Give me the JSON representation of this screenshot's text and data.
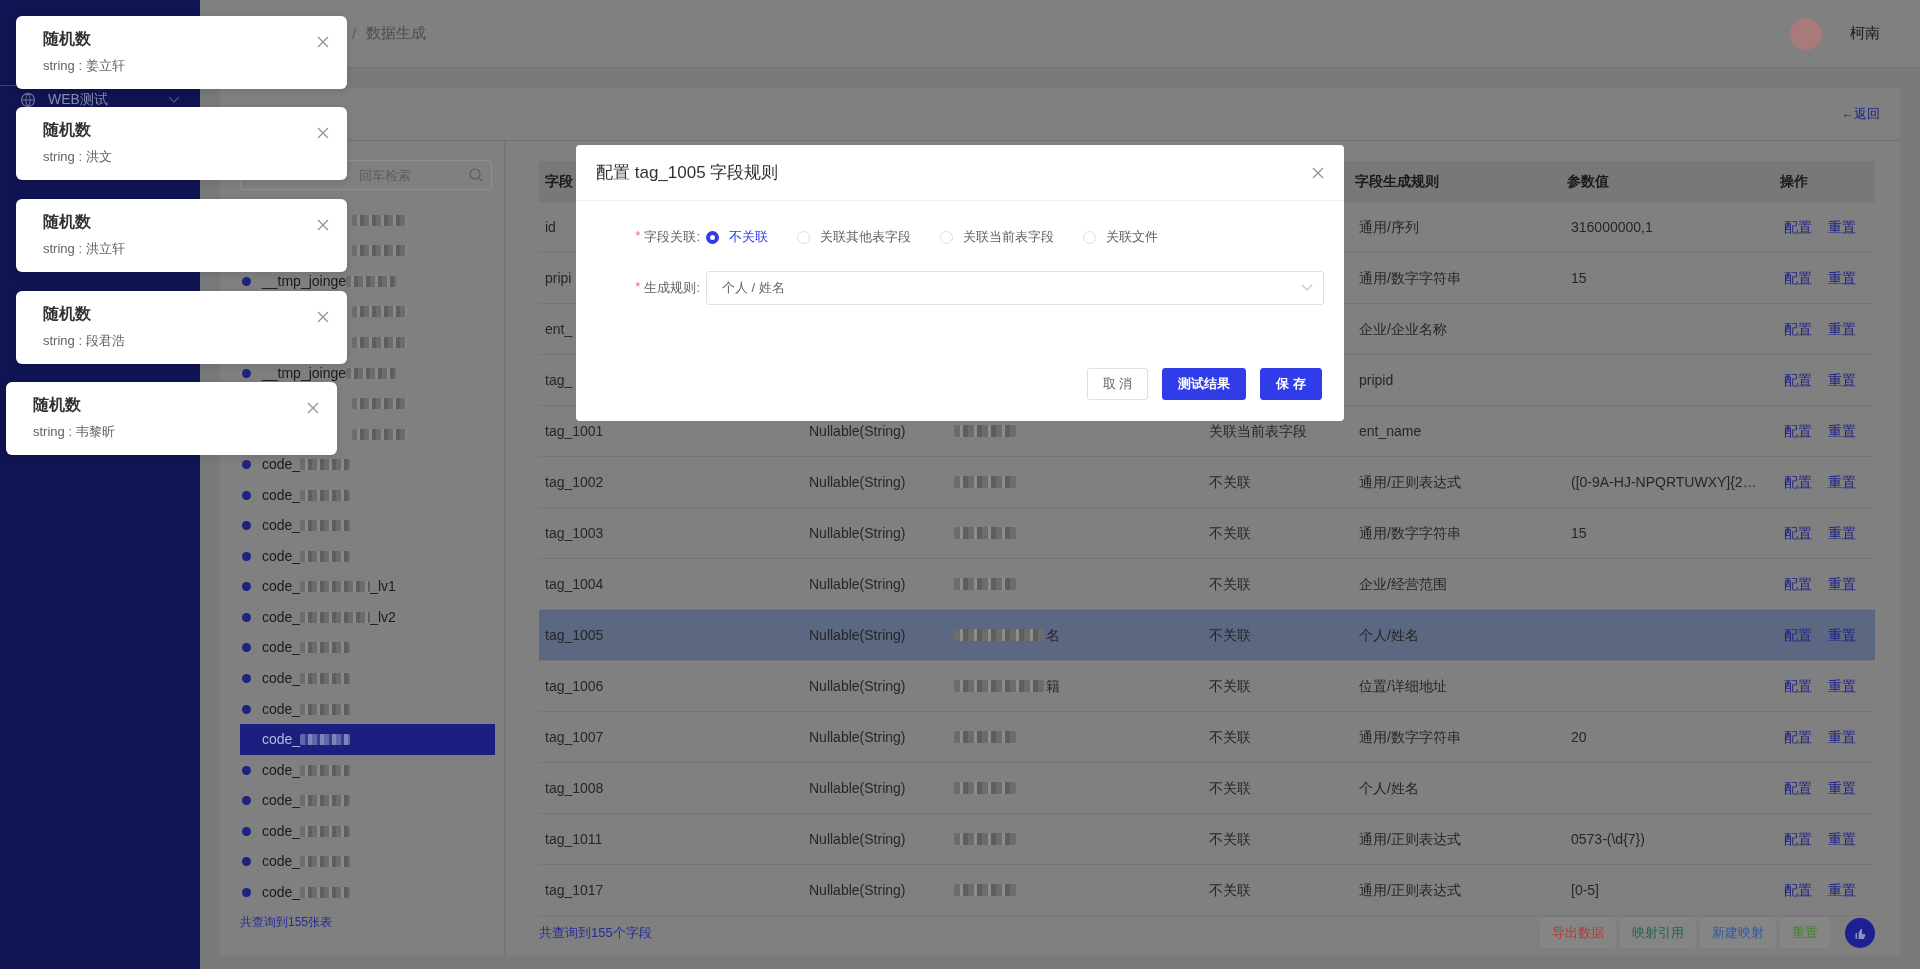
{
  "breadcrumb": {
    "separator": "/",
    "current": "数据生成"
  },
  "user": {
    "name": "柯南"
  },
  "sidebar": {
    "items": [
      {
        "label": "WEB测试",
        "expanded": false
      }
    ]
  },
  "back_link": "←返回",
  "table_list": {
    "search_placeholder": "回车检索",
    "items": [
      {
        "selected": false
      },
      {
        "selected": false
      },
      {
        "prefix": "__tmp_joinge",
        "selected": false
      },
      {
        "selected": false
      },
      {
        "selected": false
      },
      {
        "prefix": "__tmp_joinge",
        "selected": false
      },
      {
        "selected": false
      },
      {
        "selected": false
      },
      {
        "prefix": "code_",
        "selected": false
      },
      {
        "prefix": "code_",
        "selected": false
      },
      {
        "prefix": "code_",
        "selected": false
      },
      {
        "prefix": "code_",
        "selected": false
      },
      {
        "prefix": "code_",
        "suffix": "_lv1",
        "selected": false
      },
      {
        "prefix": "code_",
        "suffix": "_lv2",
        "selected": false
      },
      {
        "prefix": "code_",
        "selected": false
      },
      {
        "prefix": "code_",
        "selected": false
      },
      {
        "prefix": "code_",
        "selected": false
      },
      {
        "prefix": "code_",
        "selected": true
      },
      {
        "prefix": "code_",
        "selected": false
      },
      {
        "prefix": "code_",
        "selected": false
      },
      {
        "prefix": "code_",
        "selected": false
      },
      {
        "prefix": "code_",
        "selected": false
      },
      {
        "prefix": "code_",
        "selected": false
      }
    ],
    "footer": "共查询到155张表"
  },
  "fields_table": {
    "columns": [
      {
        "label": "字段"
      },
      {
        "label": "字段生成规则"
      },
      {
        "label": "参数值"
      },
      {
        "label": "操作"
      }
    ],
    "rows": [
      {
        "name": "id",
        "rule": "通用/序列",
        "param": "316000000,1",
        "actions": [
          "配置",
          "重置"
        ],
        "selected": false
      },
      {
        "name": "pripi",
        "rule": "通用/数字字符串",
        "param": "15",
        "actions": [
          "配置",
          "重置"
        ],
        "selected": false
      },
      {
        "name": "ent_",
        "rule": "企业/企业名称",
        "actions": [
          "配置",
          "重置"
        ],
        "selected": false
      },
      {
        "name": "tag_",
        "rule": "pripid",
        "actions": [
          "配置",
          "重置"
        ],
        "selected": false
      },
      {
        "name": "tag_1001",
        "type": "Nullable(String)",
        "relation": "关联当前表字段",
        "rule": "ent_name",
        "actions": [
          "配置",
          "重置"
        ],
        "selected": false
      },
      {
        "name": "tag_1002",
        "type": "Nullable(String)",
        "relation": "不关联",
        "rule": "通用/正则表达式",
        "param": "([0-9A-HJ-NPQRTUWXY]{2…",
        "actions": [
          "配置",
          "重置"
        ],
        "selected": false
      },
      {
        "name": "tag_1003",
        "type": "Nullable(String)",
        "relation": "不关联",
        "rule": "通用/数字字符串",
        "param": "15",
        "actions": [
          "配置",
          "重置"
        ],
        "selected": false
      },
      {
        "name": "tag_1004",
        "type": "Nullable(String)",
        "relation": "不关联",
        "rule": "企业/经营范围",
        "actions": [
          "配置",
          "重置"
        ],
        "selected": false
      },
      {
        "name": "tag_1005",
        "type": "Nullable(String)",
        "comment_tail": "名",
        "relation": "不关联",
        "rule": "个人/姓名",
        "actions": [
          "配置",
          "重置"
        ],
        "selected": true
      },
      {
        "name": "tag_1006",
        "type": "Nullable(String)",
        "comment_tail": "籍",
        "relation": "不关联",
        "rule": "位置/详细地址",
        "actions": [
          "配置",
          "重置"
        ],
        "selected": false
      },
      {
        "name": "tag_1007",
        "type": "Nullable(String)",
        "relation": "不关联",
        "rule": "通用/数字字符串",
        "param": "20",
        "actions": [
          "配置",
          "重置"
        ],
        "selected": false
      },
      {
        "name": "tag_1008",
        "type": "Nullable(String)",
        "relation": "不关联",
        "rule": "个人/姓名",
        "actions": [
          "配置",
          "重置"
        ],
        "selected": false
      },
      {
        "name": "tag_1011",
        "type": "Nullable(String)",
        "relation": "不关联",
        "rule": "通用/正则表达式",
        "param": "0573-(\\d{7})",
        "actions": [
          "配置",
          "重置"
        ],
        "selected": false
      },
      {
        "name": "tag_1017",
        "type": "Nullable(String)",
        "relation": "不关联",
        "rule": "通用/正则表达式",
        "param": "[0-5]",
        "actions": [
          "配置",
          "重置"
        ],
        "selected": false
      }
    ],
    "footer": "共查询到155个字段"
  },
  "actions": [
    {
      "label": "导出数据",
      "color": "#b23a3a"
    },
    {
      "label": "映射引用",
      "color": "#1f6457"
    },
    {
      "label": "新建映射",
      "color": "#2a5aa8"
    },
    {
      "label": "重置",
      "color": "#3b7f2c"
    }
  ],
  "dialog": {
    "title": "配置 tag_1005 字段规则",
    "fields": [
      {
        "kind": "radio",
        "required_mark": "*",
        "label": "字段关联:",
        "options": [
          {
            "label": "不关联",
            "selected": true
          },
          {
            "label": "关联其他表字段",
            "selected": false
          },
          {
            "label": "关联当前表字段",
            "selected": false
          },
          {
            "label": "关联文件",
            "selected": false
          }
        ]
      },
      {
        "kind": "select",
        "required_mark": "*",
        "label": "生成规则:",
        "value": "个人 / 姓名"
      }
    ],
    "buttons": [
      {
        "label": "取 消",
        "kind": "default"
      },
      {
        "label": "测试结果",
        "kind": "primary"
      },
      {
        "label": "保 存",
        "kind": "primary"
      }
    ]
  },
  "notifications": [
    {
      "title": "随机数",
      "message": "string : 姜立轩"
    },
    {
      "title": "随机数",
      "message": "string : 洪文"
    },
    {
      "title": "随机数",
      "message": "string : 洪立轩"
    },
    {
      "title": "随机数",
      "message": "string : 段君浩"
    },
    {
      "title": "随机数",
      "message": "string : 韦黎昕"
    }
  ]
}
